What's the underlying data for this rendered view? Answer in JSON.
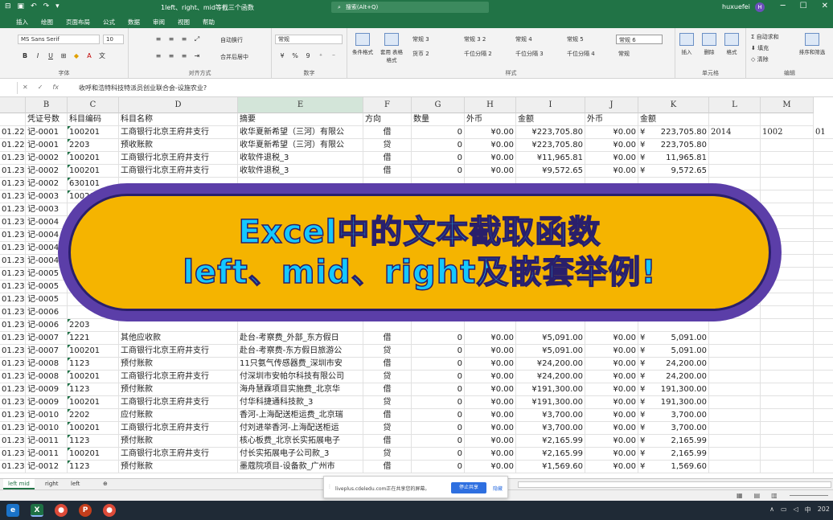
{
  "window": {
    "title": "1left、right、mid等截三个函数",
    "search_placeholder": "搜索(Alt+Q)",
    "user": "huxuefei",
    "avatar_letter": "H"
  },
  "tabs": [
    "插入",
    "绘图",
    "页面布局",
    "公式",
    "数据",
    "审阅",
    "视图",
    "帮助"
  ],
  "ribbon": {
    "font_name": "MS Sans Serif",
    "font_size": "10",
    "wrap_text": "自动换行",
    "merge_center": "合并后居中",
    "number_format": "常规",
    "percent": "%",
    "comma": "9",
    "cond_format": "条件格式",
    "table_format": "套用\n表格格式",
    "styles": [
      "常规 3",
      "常规 3 2",
      "常规 4",
      "常规 5",
      "常规 6",
      "货币 2",
      "千位分隔 2",
      "千位分隔 3",
      "千位分隔 4",
      "常规"
    ],
    "insert": "插入",
    "delete": "删除",
    "format": "格式",
    "autosum": "自动求和",
    "fill": "填充",
    "clear": "清除",
    "sort_filter": "排序和筛选",
    "group_labels": {
      "font": "字体",
      "alignment": "对齐方式",
      "number": "数字",
      "styles": "样式",
      "cells": "单元格",
      "editing": "编辑"
    }
  },
  "formula_bar": {
    "content": "收呼和浩特科技特派员创业联合会-设施农业?"
  },
  "columns": [
    "B",
    "C",
    "D",
    "E",
    "F",
    "G",
    "H",
    "I",
    "J",
    "K",
    "L",
    "M"
  ],
  "header_row": [
    "凭证号数",
    "科目编码",
    "科目名称",
    "摘要",
    "方向",
    "数量",
    "外币",
    "金额",
    "外币",
    "金额"
  ],
  "rows": [
    [
      "01.22",
      "记-0001",
      "100201",
      "工商银行北京王府井支行",
      "收华夏新希望（三河）有限公",
      "借",
      "0",
      "¥0.00",
      "¥223,705.80",
      "¥0.00",
      "¥",
      "223,705.80",
      "2014",
      "1002",
      "01"
    ],
    [
      "01.22",
      "记-0001",
      "2203",
      "预收账款",
      "收华夏新希望（三河）有限公",
      "贷",
      "0",
      "¥0.00",
      "¥223,705.80",
      "¥0.00",
      "¥",
      "223,705.80",
      "",
      "",
      ""
    ],
    [
      "01.23",
      "记-0002",
      "100201",
      "工商银行北京王府井支行",
      "收软件退税_3",
      "借",
      "0",
      "¥0.00",
      "¥11,965.81",
      "¥0.00",
      "¥",
      "11,965.81",
      "",
      "",
      ""
    ],
    [
      "01.23",
      "记-0002",
      "100201",
      "工商银行北京王府井支行",
      "收软件退税_3",
      "借",
      "0",
      "¥0.00",
      "¥9,572.65",
      "¥0.00",
      "¥",
      "9,572.65",
      "",
      "",
      ""
    ],
    [
      "01.23",
      "记-0002",
      "630101",
      "",
      "",
      "",
      "",
      "",
      "",
      "",
      "",
      "",
      "",
      "",
      ""
    ],
    [
      "01.23",
      "记-0003",
      "100201",
      "",
      "",
      "",
      "",
      "",
      "",
      "",
      "",
      "",
      "",
      "",
      ""
    ],
    [
      "01.23",
      "记-0003",
      "",
      "",
      "",
      "",
      "",
      "",
      "",
      "",
      "",
      "",
      "",
      "",
      ""
    ],
    [
      "01.23",
      "记-0004",
      "",
      "",
      "",
      "",
      "",
      "",
      "",
      "",
      "",
      "",
      "",
      "",
      ""
    ],
    [
      "01.23",
      "记-0004",
      "",
      "",
      "",
      "",
      "",
      "",
      "",
      "",
      "",
      "",
      "",
      "",
      ""
    ],
    [
      "01.23",
      "记-0004",
      "",
      "",
      "",
      "",
      "",
      "",
      "",
      "",
      "",
      "",
      "",
      "",
      ""
    ],
    [
      "01.23",
      "记-0004",
      "",
      "",
      "",
      "",
      "",
      "",
      "",
      "",
      "",
      "",
      "",
      "",
      ""
    ],
    [
      "01.23",
      "记-0005",
      "",
      "",
      "",
      "",
      "",
      "",
      "",
      "",
      "",
      "",
      "",
      "",
      ""
    ],
    [
      "01.23",
      "记-0005",
      "",
      "",
      "",
      "",
      "",
      "",
      "",
      "",
      "",
      "",
      "",
      "",
      ""
    ],
    [
      "01.23",
      "记-0005",
      "",
      "",
      "",
      "",
      "",
      "",
      "",
      "",
      "",
      "",
      "",
      "",
      ""
    ],
    [
      "01.23",
      "记-0006",
      "",
      "",
      "",
      "",
      "",
      "",
      "",
      "",
      "",
      "",
      "",
      "",
      ""
    ],
    [
      "01.23",
      "记-0006",
      "2203",
      "",
      "",
      "",
      "",
      "",
      "",
      "",
      "",
      "",
      "",
      "",
      ""
    ],
    [
      "01.23",
      "记-0007",
      "1221",
      "其他应收款",
      "赴台-考察费_外部_东方假日",
      "借",
      "0",
      "¥0.00",
      "¥5,091.00",
      "¥0.00",
      "¥",
      "5,091.00",
      "",
      "",
      ""
    ],
    [
      "01.23",
      "记-0007",
      "100201",
      "工商银行北京王府井支行",
      "赴台-考察费-东方假日旅游公",
      "贷",
      "0",
      "¥0.00",
      "¥5,091.00",
      "¥0.00",
      "¥",
      "5,091.00",
      "",
      "",
      ""
    ],
    [
      "01.23",
      "记-0008",
      "1123",
      "预付账款",
      "11只氨气传感器费_深圳市安",
      "借",
      "0",
      "¥0.00",
      "¥24,200.00",
      "¥0.00",
      "¥",
      "24,200.00",
      "",
      "",
      ""
    ],
    [
      "01.23",
      "记-0008",
      "100201",
      "工商银行北京王府井支行",
      "付深圳市安帕尔科技有限公司",
      "贷",
      "0",
      "¥0.00",
      "¥24,200.00",
      "¥0.00",
      "¥",
      "24,200.00",
      "",
      "",
      ""
    ],
    [
      "01.23",
      "记-0009",
      "1123",
      "预付账款",
      "海舟慧霖项目实施费_北京华",
      "借",
      "0",
      "¥0.00",
      "¥191,300.00",
      "¥0.00",
      "¥",
      "191,300.00",
      "",
      "",
      ""
    ],
    [
      "01.23",
      "记-0009",
      "100201",
      "工商银行北京王府井支行",
      "付华科捷通科技款_3",
      "贷",
      "0",
      "¥0.00",
      "¥191,300.00",
      "¥0.00",
      "¥",
      "191,300.00",
      "",
      "",
      ""
    ],
    [
      "01.23",
      "记-0010",
      "2202",
      "应付账款",
      "香河-上海配送柜运费_北京瑞",
      "借",
      "0",
      "¥0.00",
      "¥3,700.00",
      "¥0.00",
      "¥",
      "3,700.00",
      "",
      "",
      ""
    ],
    [
      "01.23",
      "记-0010",
      "100201",
      "工商银行北京王府井支行",
      "付刘进举香河-上海配送柜运",
      "贷",
      "0",
      "¥0.00",
      "¥3,700.00",
      "¥0.00",
      "¥",
      "3,700.00",
      "",
      "",
      ""
    ],
    [
      "01.23",
      "记-0011",
      "1123",
      "预付账款",
      "核心板费_北京长实拓展电子",
      "借",
      "0",
      "¥0.00",
      "¥2,165.99",
      "¥0.00",
      "¥",
      "2,165.99",
      "",
      "",
      ""
    ],
    [
      "01.23",
      "记-0011",
      "100201",
      "工商银行北京王府井支行",
      "付长实拓展电子公司款_3",
      "贷",
      "0",
      "¥0.00",
      "¥2,165.99",
      "¥0.00",
      "¥",
      "2,165.99",
      "",
      "",
      ""
    ],
    [
      "01.23",
      "记-0012",
      "1123",
      "预付账款",
      "墨蔻院项目-设备款_广州市",
      "借",
      "0",
      "¥0.00",
      "¥1,569.60",
      "¥0.00",
      "¥",
      "1,569.60",
      "",
      "",
      ""
    ]
  ],
  "sheet_tabs": [
    "left mid",
    "right",
    "left"
  ],
  "share_bar": {
    "message": "liveplus.cdeledu.com正在共享您的屏幕。",
    "stop": "停止共享",
    "hide": "隐藏"
  },
  "banner": {
    "line1": "Excel中的文本截取函数",
    "line2": "left、mid、right及嵌套举例!"
  },
  "taskbar": {
    "lang": "中",
    "year": "202"
  }
}
